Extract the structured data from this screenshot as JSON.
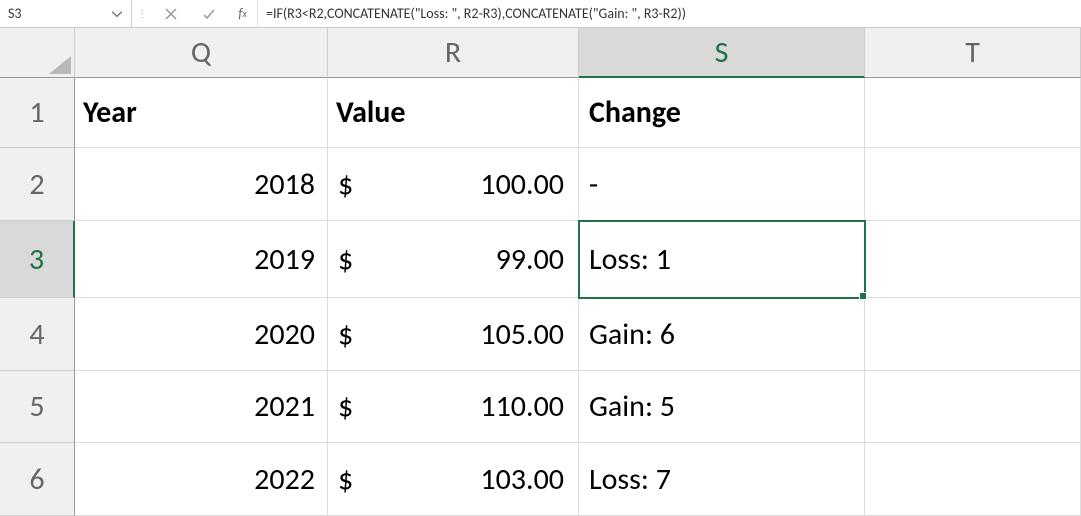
{
  "formula_bar": {
    "name_box": "S3",
    "fx_label": "fx",
    "formula": "=IF(R3<R2,CONCATENATE(\"Loss: \", R2-R3),CONCATENATE(\"Gain: \", R3-R2))"
  },
  "columns": [
    "Q",
    "R",
    "S",
    "T"
  ],
  "row_numbers": [
    "1",
    "2",
    "3",
    "4",
    "5",
    "6"
  ],
  "headers": {
    "Q": "Year",
    "R": "Value",
    "S": "Change"
  },
  "data": [
    {
      "year": "2018",
      "currency": "$",
      "value": "100.00",
      "change": "-"
    },
    {
      "year": "2019",
      "currency": "$",
      "value": "99.00",
      "change": "Loss: 1"
    },
    {
      "year": "2020",
      "currency": "$",
      "value": "105.00",
      "change": "Gain: 6"
    },
    {
      "year": "2021",
      "currency": "$",
      "value": "110.00",
      "change": "Gain: 5"
    },
    {
      "year": "2022",
      "currency": "$",
      "value": "103.00",
      "change": "Loss: 7"
    }
  ],
  "active_cell": {
    "col": "S",
    "row": 3
  }
}
